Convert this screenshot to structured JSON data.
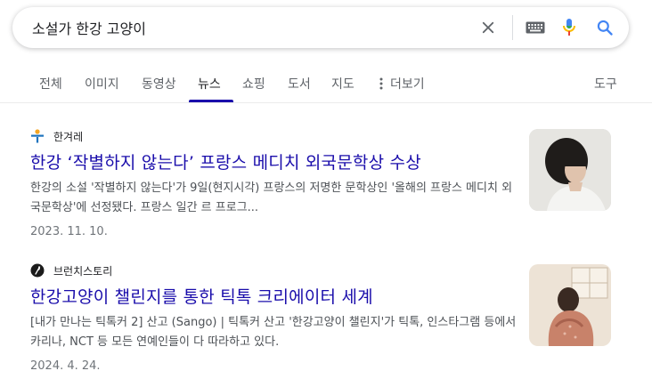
{
  "search": {
    "query": "소설가 한강 고양이"
  },
  "tabs": {
    "all": "전체",
    "images": "이미지",
    "videos": "동영상",
    "news": "뉴스",
    "shopping": "쇼핑",
    "books": "도서",
    "maps": "지도",
    "more": "더보기",
    "tools": "도구"
  },
  "results": [
    {
      "source": "한겨레",
      "title": "한강 ‘작별하지 않는다’ 프랑스 메디치 외국문학상 수상",
      "snippet": "한강의 소설 '작별하지 않는다'가 9일(현지시각) 프랑스의 저명한 문학상인 '올해의 프랑스 메디치 외국문학상'에 선정됐다. 프랑스 일간 르 프로그...",
      "date": "2023. 11. 10."
    },
    {
      "source": "브런치스토리",
      "title": "한강고양이 챌린지를 통한 틱톡 크리에이터 세계",
      "snippet": "[내가 만나는 틱톡커 2] 산고 (Sango) | 틱톡커 산고 '한강고양이 챌린지'가 틱톡, 인스타그램 등에서 카리나, NCT 등 모든 연예인들이 다 따라하고 있다.",
      "date": "2024. 4. 24."
    }
  ],
  "colors": {
    "link": "#1a0dab",
    "snippet": "#4d5156",
    "date": "#70757a",
    "search_icon": "#4285f4"
  }
}
